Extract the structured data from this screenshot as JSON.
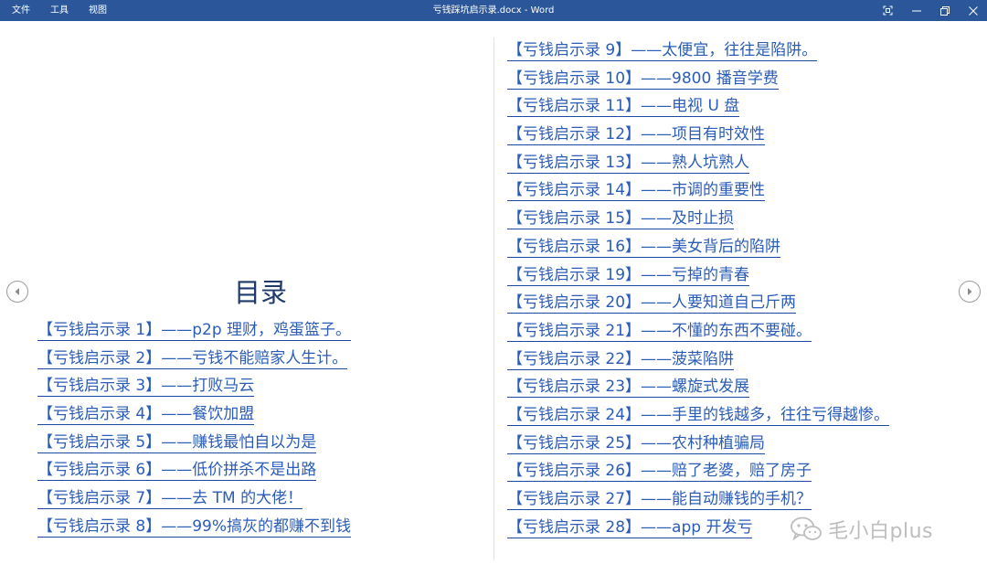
{
  "titlebar": {
    "menu": [
      "文件",
      "工具",
      "视图"
    ],
    "title": "亏钱踩坑启示录.docx - Word",
    "bg_color": "#2b579a"
  },
  "toc": {
    "heading": "目录",
    "left_entries": [
      "【亏钱启示录 1】——p2p 理财，鸡蛋篮子。",
      "【亏钱启示录 2】——亏钱不能赔家人生计。",
      "【亏钱启示录 3】——打败马云",
      "【亏钱启示录 4】——餐饮加盟",
      "【亏钱启示录 5】——赚钱最怕自以为是",
      "【亏钱启示录 6】——低价拼杀不是出路",
      "【亏钱启示录 7】——去 TM 的大佬！",
      "【亏钱启示录 8】——99%搞灰的都赚不到钱"
    ],
    "right_entries": [
      "【亏钱启示录 9】——太便宜，往往是陷阱。",
      "【亏钱启示录 10】——9800 播音学费",
      "【亏钱启示录 11】——电视 U 盘",
      "【亏钱启示录 12】——项目有时效性",
      "【亏钱启示录 13】——熟人坑熟人",
      "【亏钱启示录 14】——市调的重要性",
      "【亏钱启示录 15】——及时止损",
      "【亏钱启示录 16】——美女背后的陷阱",
      "【亏钱启示录 19】——亏掉的青春",
      "【亏钱启示录 20】——人要知道自己斤两",
      "【亏钱启示录 21】——不懂的东西不要碰。",
      "【亏钱启示录 22】——菠菜陷阱",
      "【亏钱启示录 23】——螺旋式发展",
      "【亏钱启示录 24】——手里的钱越多，往往亏得越惨。",
      "【亏钱启示录 25】——农村种植骗局",
      "【亏钱启示录 26】——赔了老婆，赔了房子",
      "【亏钱启示录 27】——能自动赚钱的手机？",
      "【亏钱启示录 28】——app 开发亏"
    ],
    "link_color": "#2a5cb8"
  },
  "navigation": {
    "prev_icon": "chevron-left-icon",
    "next_icon": "chevron-right-icon"
  },
  "watermark": {
    "icon": "wechat-icon",
    "text": "毛小白plus"
  }
}
